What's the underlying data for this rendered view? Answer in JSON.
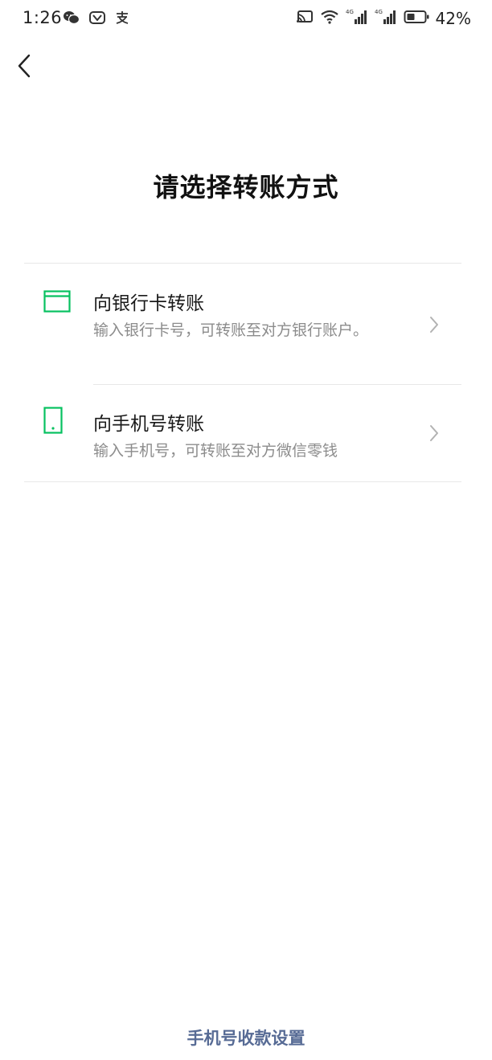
{
  "status_bar": {
    "time": "1:26",
    "battery_percent": "42%",
    "left_icons": [
      "wechat-icon",
      "app-icon",
      "alipay-icon"
    ],
    "right_icons": [
      "cast-icon",
      "wifi-icon",
      "signal-4g-icon",
      "signal-4g-icon",
      "battery-icon"
    ]
  },
  "header": {
    "back_icon": "chevron-left-icon"
  },
  "page": {
    "title": "请选择转账方式"
  },
  "options": [
    {
      "title": "向银行卡转账",
      "description": "输入银行卡号，可转账至对方银行账户。",
      "icon": "bank-card-icon"
    },
    {
      "title": "向手机号转账",
      "description": "输入手机号，可转账至对方微信零钱",
      "icon": "phone-icon"
    }
  ],
  "footer": {
    "link_label": "手机号收款设置"
  },
  "colors": {
    "accent_green": "#07c160",
    "link_blue": "#576b95",
    "secondary_text": "#8c8c8c",
    "divider": "#e8e8e8"
  }
}
